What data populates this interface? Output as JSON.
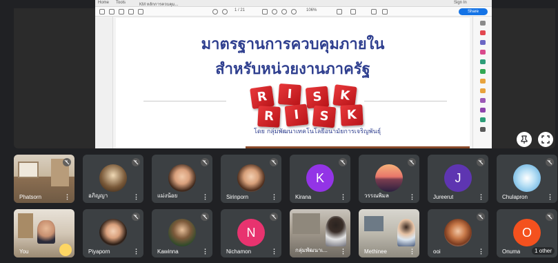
{
  "share": {
    "app_title": "Home    Tools",
    "tab_title": "KM หลักการควบคุม...",
    "top_right": "Sign In",
    "menu_items": [
      "Home",
      "Tools",
      "KM หลักการควบคุม..."
    ],
    "page_indicator": "1 / 21",
    "zoom": "106%",
    "share_button": "Share"
  },
  "slide": {
    "title_line1": "มาตรฐานการควบคุมภายใน",
    "title_line2": "สำหรับหน่วยงานภาครัฐ",
    "dice_letters": [
      "R",
      "I",
      "S",
      "K",
      "R",
      "I",
      "S",
      "K"
    ],
    "byline": "โดย กลุ่มพัฒนาเทคโนโลยีอนามัยการเจริญพันธุ์"
  },
  "participants": [
    {
      "name": "Phatsorn",
      "kind": "video"
    },
    {
      "name": "อภิญญา",
      "kind": "photo"
    },
    {
      "name": "แม่งน้อย",
      "kind": "photo"
    },
    {
      "name": "Sirinporn",
      "kind": "photo"
    },
    {
      "name": "Kirana",
      "kind": "letter",
      "letter": "K",
      "color": "#9334e6"
    },
    {
      "name": "วรรณพิมล",
      "kind": "photo"
    },
    {
      "name": "Jureerut",
      "kind": "letter",
      "letter": "J",
      "color": "#5e35b1"
    },
    {
      "name": "Chulapron",
      "kind": "photo"
    },
    {
      "name": "You",
      "kind": "video"
    },
    {
      "name": "Piyaporn",
      "kind": "photo"
    },
    {
      "name": "Kawinna",
      "kind": "photo"
    },
    {
      "name": "Nichamon",
      "kind": "letter",
      "letter": "N",
      "color": "#e8336f"
    },
    {
      "name": "กลุ่มพัฒนาเ...",
      "kind": "video"
    },
    {
      "name": "Methinee",
      "kind": "video"
    },
    {
      "name": "ooi",
      "kind": "photo"
    },
    {
      "name": "Onuma",
      "kind": "letter",
      "letter": "O",
      "color": "#f4511e"
    }
  ],
  "others_label": "1 other",
  "more_glyph": "⋮",
  "colors": {
    "background": "#202124",
    "tile": "#3c4043",
    "accent": "#1473e6",
    "slide_title": "#2f3f8f"
  }
}
